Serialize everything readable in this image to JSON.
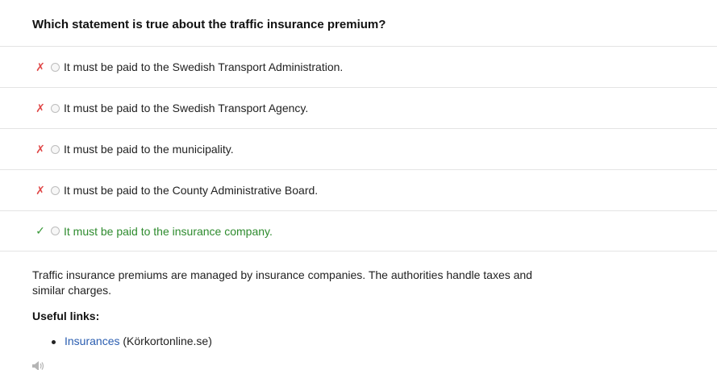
{
  "question": "Which statement is true about the traffic insurance premium?",
  "answers": [
    {
      "mark": "✗",
      "text": "It must be paid to the Swedish Transport Administration.",
      "correct": false
    },
    {
      "mark": "✗",
      "text": "It must be paid to the Swedish Transport Agency.",
      "correct": false
    },
    {
      "mark": "✗",
      "text": "It must be paid to the municipality.",
      "correct": false
    },
    {
      "mark": "✗",
      "text": "It must be paid to the County Administrative Board.",
      "correct": false
    },
    {
      "mark": "✓",
      "text": "It must be paid to the insurance company.",
      "correct": true
    }
  ],
  "explanation": "Traffic insurance premiums are managed by insurance companies. The authorities handle taxes and similar charges.",
  "useful_links": {
    "heading": "Useful links:",
    "items": [
      {
        "link_text": "Insurances",
        "suffix": " (Körkortonline.se)"
      }
    ]
  },
  "icons": {
    "wrong": "x-mark-icon",
    "right": "checkmark-icon",
    "audio": "speaker-icon"
  },
  "colors": {
    "wrong_mark": "#e04848",
    "right_mark": "#3b9a3b",
    "correct_text": "#2e8b2e",
    "link": "#2a5db0"
  }
}
